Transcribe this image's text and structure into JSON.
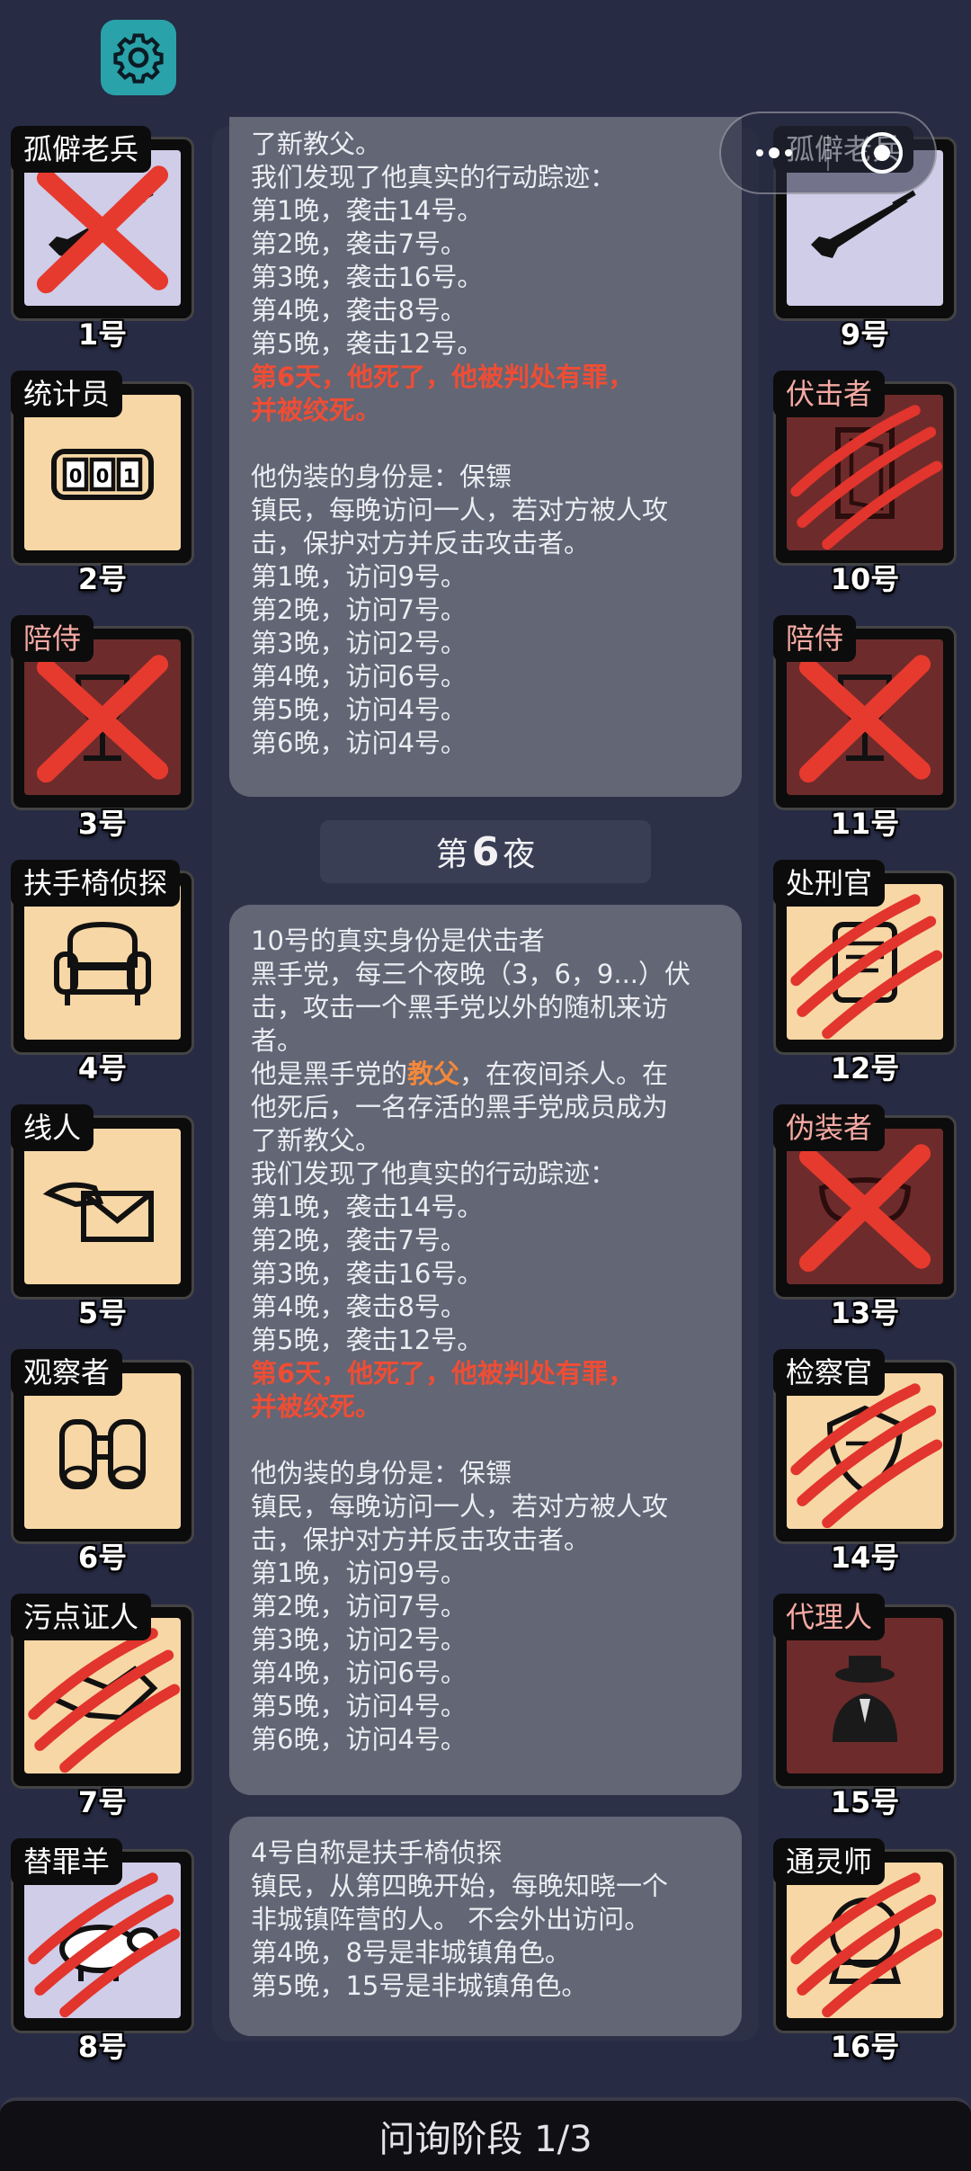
{
  "left_players": [
    {
      "name": "孤僻老兵",
      "number": "1号",
      "icon": "rifle-icon",
      "bg": "lav",
      "mark": "x",
      "name_color": "white"
    },
    {
      "name": "统计员",
      "number": "2号",
      "icon": "counter-icon",
      "bg": "peach",
      "mark": "none",
      "name_color": "white"
    },
    {
      "name": "陪侍",
      "number": "3号",
      "icon": "wineglass-icon",
      "bg": "maroon",
      "mark": "x",
      "name_color": "pink"
    },
    {
      "name": "扶手椅侦探",
      "number": "4号",
      "icon": "armchair-icon",
      "bg": "peach",
      "mark": "none",
      "name_color": "white"
    },
    {
      "name": "线人",
      "number": "5号",
      "icon": "envelope-icon",
      "bg": "peach",
      "mark": "none",
      "name_color": "white"
    },
    {
      "name": "观察者",
      "number": "6号",
      "icon": "binoculars-icon",
      "bg": "peach",
      "mark": "none",
      "name_color": "white"
    },
    {
      "name": "污点证人",
      "number": "7号",
      "icon": "handshake-icon",
      "bg": "peach",
      "mark": "claw",
      "name_color": "white"
    },
    {
      "name": "替罪羊",
      "number": "8号",
      "icon": "sheep-icon",
      "bg": "lav",
      "mark": "claw",
      "name_color": "white"
    }
  ],
  "right_players": [
    {
      "name": "孤僻老兵",
      "number": "9号",
      "icon": "rifle-icon",
      "bg": "lav",
      "mark": "none",
      "name_color": "white"
    },
    {
      "name": "伏击者",
      "number": "10号",
      "icon": "door-icon",
      "bg": "maroon",
      "mark": "claw",
      "name_color": "pink"
    },
    {
      "name": "陪侍",
      "number": "11号",
      "icon": "wineglass-icon",
      "bg": "maroon",
      "mark": "x",
      "name_color": "pink"
    },
    {
      "name": "处刑官",
      "number": "12号",
      "icon": "scroll-icon",
      "bg": "peach",
      "mark": "claw",
      "name_color": "white"
    },
    {
      "name": "伪装者",
      "number": "13号",
      "icon": "mask-icon",
      "bg": "maroon",
      "mark": "x",
      "name_color": "pink"
    },
    {
      "name": "检察官",
      "number": "14号",
      "icon": "crest-icon",
      "bg": "peach",
      "mark": "claw",
      "name_color": "white"
    },
    {
      "name": "代理人",
      "number": "15号",
      "icon": "agent-icon",
      "bg": "maroon",
      "mark": "none",
      "name_color": "pink"
    },
    {
      "name": "通灵师",
      "number": "16号",
      "icon": "crystal-ball-icon",
      "bg": "peach",
      "mark": "claw",
      "name_color": "white"
    }
  ],
  "message1_lines": [
    "了新教父。",
    "我们发现了他真实的行动踪迹：",
    "第1晚，袭击14号。",
    "第2晚，袭击7号。",
    "第3晚，袭击16号。",
    "第4晚，袭击8号。",
    "第5晚，袭击12号。"
  ],
  "message1_death": [
    "第6天，他死了，他被判处有罪，",
    "并被绞死。"
  ],
  "message1_disguise": [
    "他伪装的身份是：保镖",
    "镇民，每晚访问一人，若对方被人攻",
    "击，保护对方并反击攻击者。",
    "第1晚，访问9号。",
    "第2晚，访问7号。",
    "第3晚，访问2号。",
    "第4晚，访问6号。",
    "第5晚，访问4号。",
    "第6晚，访问4号。"
  ],
  "night_label": {
    "prefix": "第",
    "num": "6",
    "suffix": "夜"
  },
  "message2_intro": [
    "10号的真实身份是伏击者",
    "黑手党，每三个夜晚（3，6，9...）伏",
    "击，攻击一个黑手党以外的随机来访",
    "者。"
  ],
  "message2_role": {
    "pre": "他是黑手党的",
    "hl": "教父",
    "post": "，在夜间杀人。在"
  },
  "message2_lines": [
    "他死后，一名存活的黑手党成员成为",
    "了新教父。",
    "我们发现了他真实的行动踪迹：",
    "第1晚，袭击14号。",
    "第2晚，袭击7号。",
    "第3晚，袭击16号。",
    "第4晚，袭击8号。",
    "第5晚，袭击12号。"
  ],
  "message2_death": [
    "第6天，他死了，他被判处有罪，",
    "并被绞死。"
  ],
  "message2_disguise": [
    "他伪装的身份是：保镖",
    "镇民，每晚访问一人，若对方被人攻",
    "击，保护对方并反击攻击者。",
    "第1晚，访问9号。",
    "第2晚，访问7号。",
    "第3晚，访问2号。",
    "第4晚，访问6号。",
    "第5晚，访问4号。",
    "第6晚，访问4号。"
  ],
  "message3_lines": [
    "4号自称是扶手椅侦探",
    "镇民，从第四晚开始，每晚知晓一个",
    "非城镇阵营的人。 不会外出访问。",
    "第4晚，8号是非城镇角色。",
    "第5晚，15号是非城镇角色。"
  ],
  "bottom_bar": "问询阶段 1/3",
  "colors": {
    "background": "#272b44",
    "message": "#626675",
    "accent_red": "#ee4d35",
    "accent_orange": "#f3883a",
    "gear": "#2aa2a9"
  }
}
